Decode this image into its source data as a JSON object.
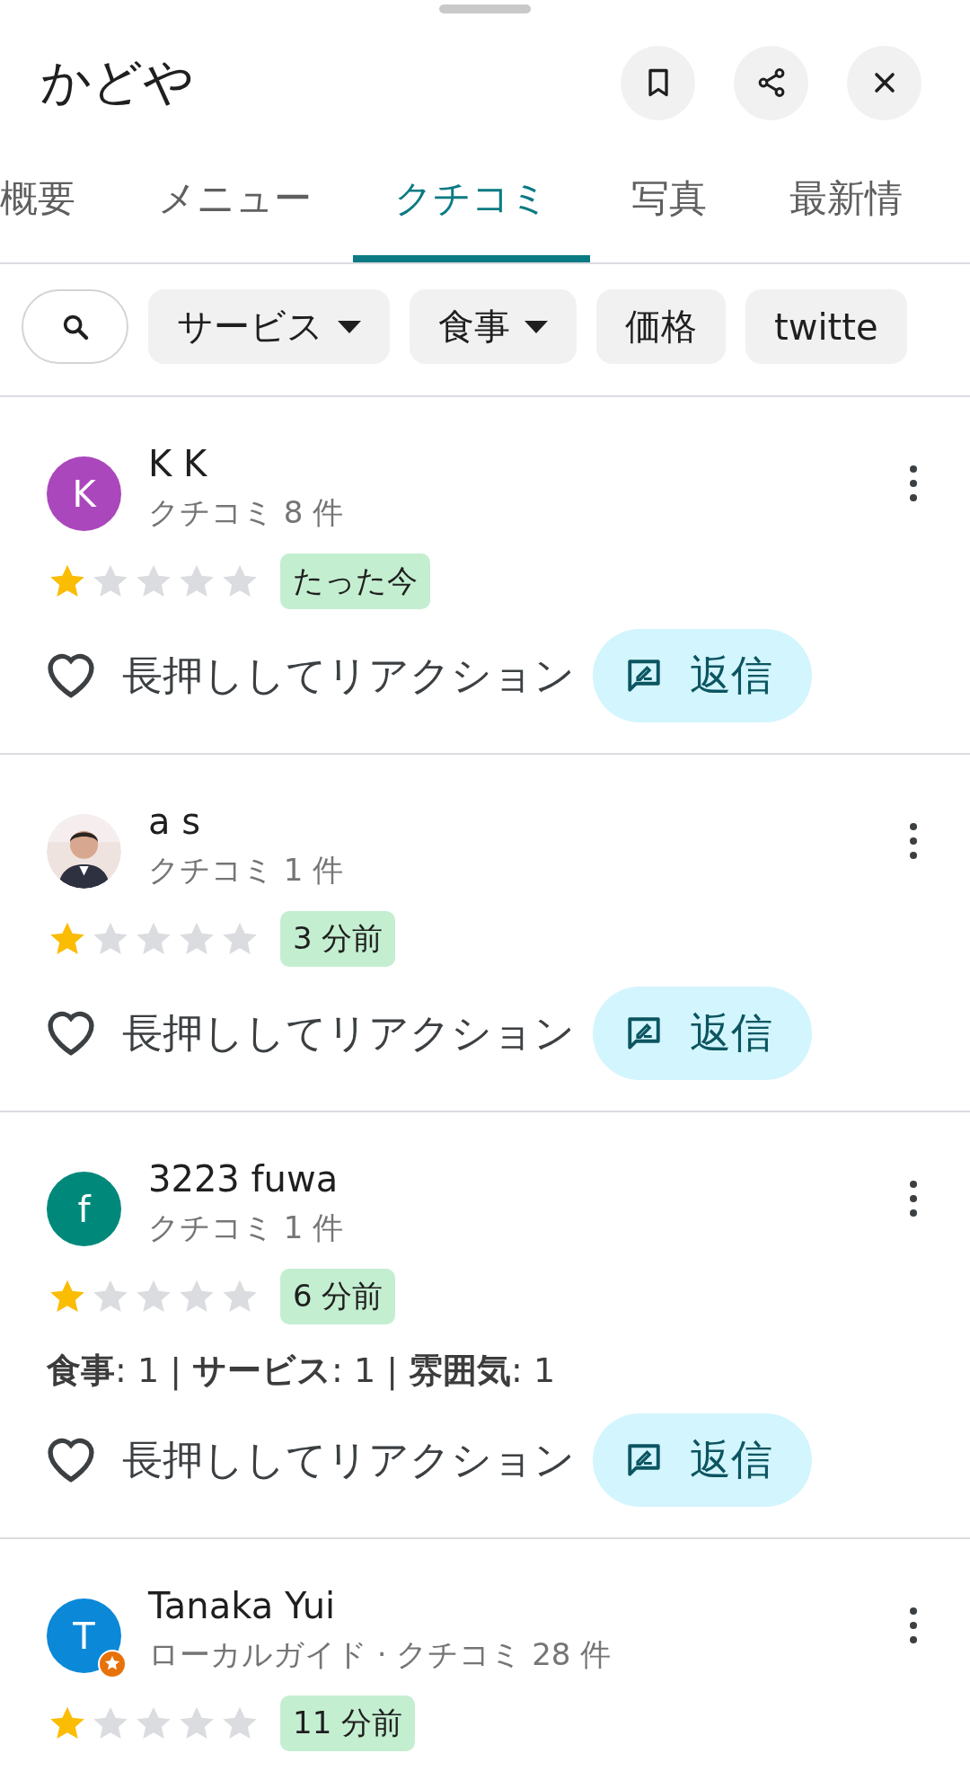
{
  "sheet": {
    "title": "かどや",
    "actions": [
      {
        "kind": "bookmark"
      },
      {
        "kind": "share"
      },
      {
        "kind": "close"
      }
    ]
  },
  "tabs": [
    {
      "label": "概要",
      "selected": false
    },
    {
      "label": "メニュー",
      "selected": false
    },
    {
      "label": "クチコミ",
      "selected": true
    },
    {
      "label": "写真",
      "selected": false
    },
    {
      "label": "最新情",
      "selected": false
    }
  ],
  "filters": [
    {
      "kind": "search"
    },
    {
      "kind": "dropdown",
      "label": "サービス"
    },
    {
      "kind": "dropdown",
      "label": "食事"
    },
    {
      "kind": "chip",
      "label": "価格"
    },
    {
      "kind": "chip",
      "label": "twitte"
    }
  ],
  "reviews": [
    {
      "author": "K K",
      "avatar": {
        "kind": "letter",
        "letter": "K",
        "color": "#ab47bc"
      },
      "local_guide": false,
      "meta": "クチコミ 8 件",
      "stars": 1,
      "time": "たった今",
      "reaction": "長押ししてリアクション",
      "reply": "返信"
    },
    {
      "author": "a s",
      "local_guide": false,
      "meta": "クチコミ 1 件",
      "stars": 1,
      "time": "3 分前",
      "reaction": "長押ししてリアクション",
      "reply": "返信"
    },
    {
      "author": "3223 fuwa",
      "avatar": {
        "kind": "letter",
        "letter": "f",
        "color": "#00897b"
      },
      "local_guide": false,
      "meta": "クチコミ 1 件",
      "stars": 1,
      "time": "6 分前",
      "ratings": "**食事**: 1 | **サービス**: 1 | **雰囲気**: 1",
      "reaction": "長押ししてリアクション",
      "reply": "返信"
    },
    {
      "author": "Tanaka Yui",
      "avatar": {
        "kind": "letter",
        "letter": "T",
        "color": "#0b88d8"
      },
      "local_guide": true,
      "meta": "ローカルガイド · クチコミ 28 件",
      "stars": 1,
      "time": "11 分前"
    }
  ]
}
